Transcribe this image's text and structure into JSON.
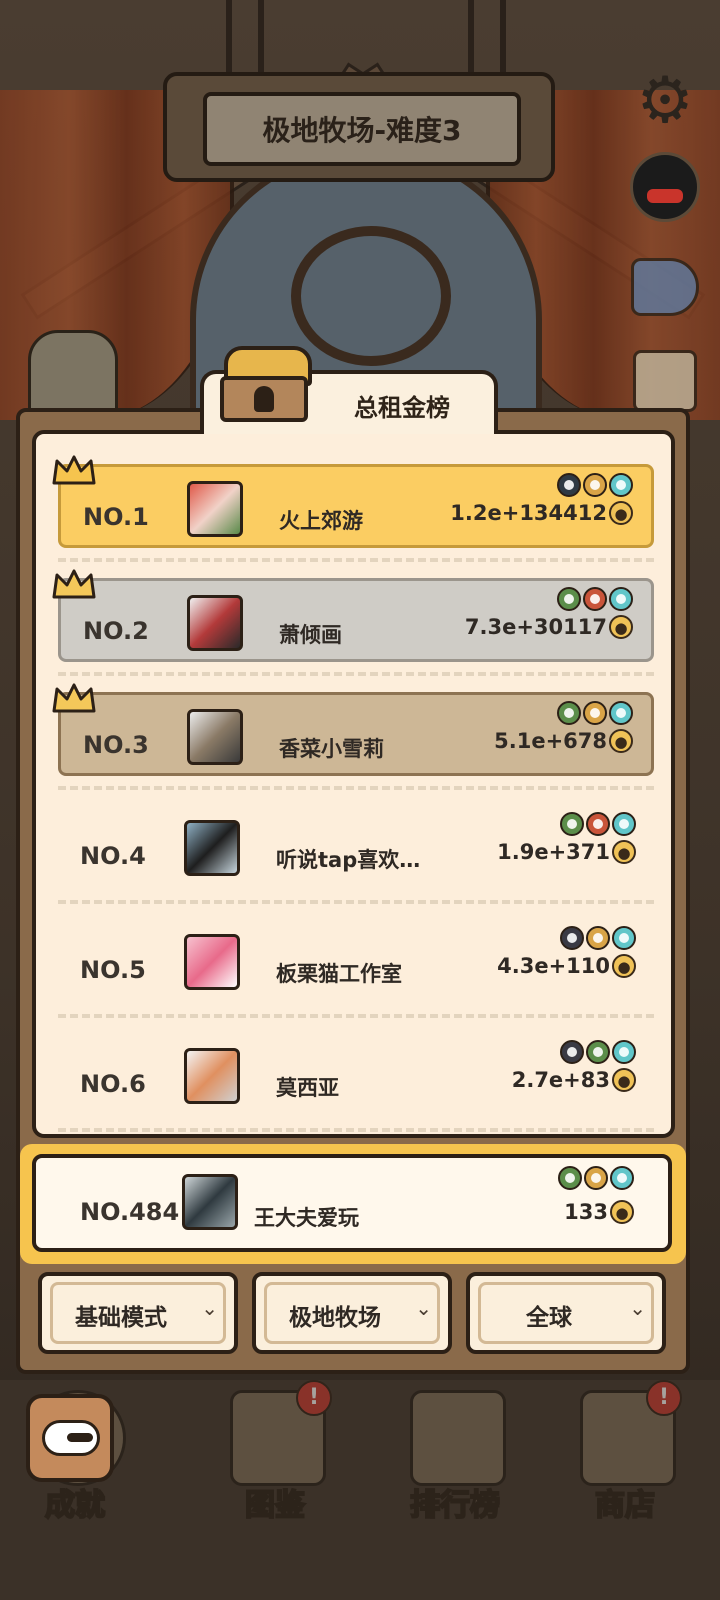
{
  "header": {
    "level_title": "极地牧场-难度3"
  },
  "leaderboard": {
    "tab_title": "总租金榜",
    "entries": [
      {
        "rank": "NO.1",
        "name": "火上郊游",
        "score": "1.2e+134412",
        "tier": "gold",
        "avatar_colors": [
          "#e05a4a",
          "#f1d2c8",
          "#5a8a4a"
        ],
        "badge_colors": [
          "#2f3a44",
          "#d9a447",
          "#61c6c9"
        ]
      },
      {
        "rank": "NO.2",
        "name": "萧倾画",
        "score": "7.3e+30117",
        "tier": "silver",
        "avatar_colors": [
          "#f0f0f0",
          "#b33a3a",
          "#2a2a2a"
        ],
        "badge_colors": [
          "#5b8e4a",
          "#c9543a",
          "#61c6c9"
        ]
      },
      {
        "rank": "NO.3",
        "name": "香菜小雪莉",
        "score": "5.1e+678",
        "tier": "bronze",
        "avatar_colors": [
          "#ececec",
          "#8a7a66",
          "#3a3a3a"
        ],
        "badge_colors": [
          "#5b8e4a",
          "#d9a447",
          "#61c6c9"
        ]
      },
      {
        "rank": "NO.4",
        "name": "听说tap喜欢…",
        "score": "1.9e+371",
        "tier": "plain",
        "avatar_colors": [
          "#8fb0c4",
          "#1e1e1e",
          "#c7d6de"
        ],
        "badge_colors": [
          "#5b8e4a",
          "#c9543a",
          "#61c6c9"
        ]
      },
      {
        "rank": "NO.5",
        "name": "板栗猫工作室",
        "score": "4.3e+110",
        "tier": "plain",
        "avatar_colors": [
          "#f7c2cf",
          "#e86a8a",
          "#ffffff"
        ],
        "badge_colors": [
          "#3a3a44",
          "#d9a447",
          "#61c6c9"
        ]
      },
      {
        "rank": "NO.6",
        "name": "莫西亚",
        "score": "2.7e+83",
        "tier": "plain",
        "avatar_colors": [
          "#f4f4f4",
          "#e09060",
          "#d0d0d0"
        ],
        "badge_colors": [
          "#3a3a44",
          "#5b8e4a",
          "#61c6c9"
        ]
      }
    ],
    "me": {
      "rank": "NO.484",
      "name": "王大夫爱玩",
      "score": "133",
      "avatar_colors": [
        "#cfd6d8",
        "#2f3a40",
        "#9aa6aa"
      ],
      "badge_colors": [
        "#5b8e4a",
        "#d9a447",
        "#61c6c9"
      ]
    }
  },
  "filters": [
    {
      "label": "基础模式"
    },
    {
      "label": "极地牧场"
    },
    {
      "label": "全球"
    }
  ],
  "bottom_nav": [
    {
      "label": "成就",
      "badge": ""
    },
    {
      "label": "图鉴",
      "badge": "!"
    },
    {
      "label": "排行榜",
      "badge": ""
    },
    {
      "label": "商店",
      "badge": "!"
    }
  ],
  "colors": {
    "gold": "#fbcd62",
    "silver": "#cfccc6",
    "bronze": "#cdb796",
    "panel": "#8a6a4a",
    "card": "#fdeedb"
  },
  "icons": [
    "settings-gear-icon",
    "qq-icon",
    "announcement-horn-icon",
    "calendar-checkin-icon",
    "treasure-chest-icon",
    "crown-icon",
    "paw-coin-icon",
    "back-arrow-icon",
    "chevron-down-icon"
  ]
}
